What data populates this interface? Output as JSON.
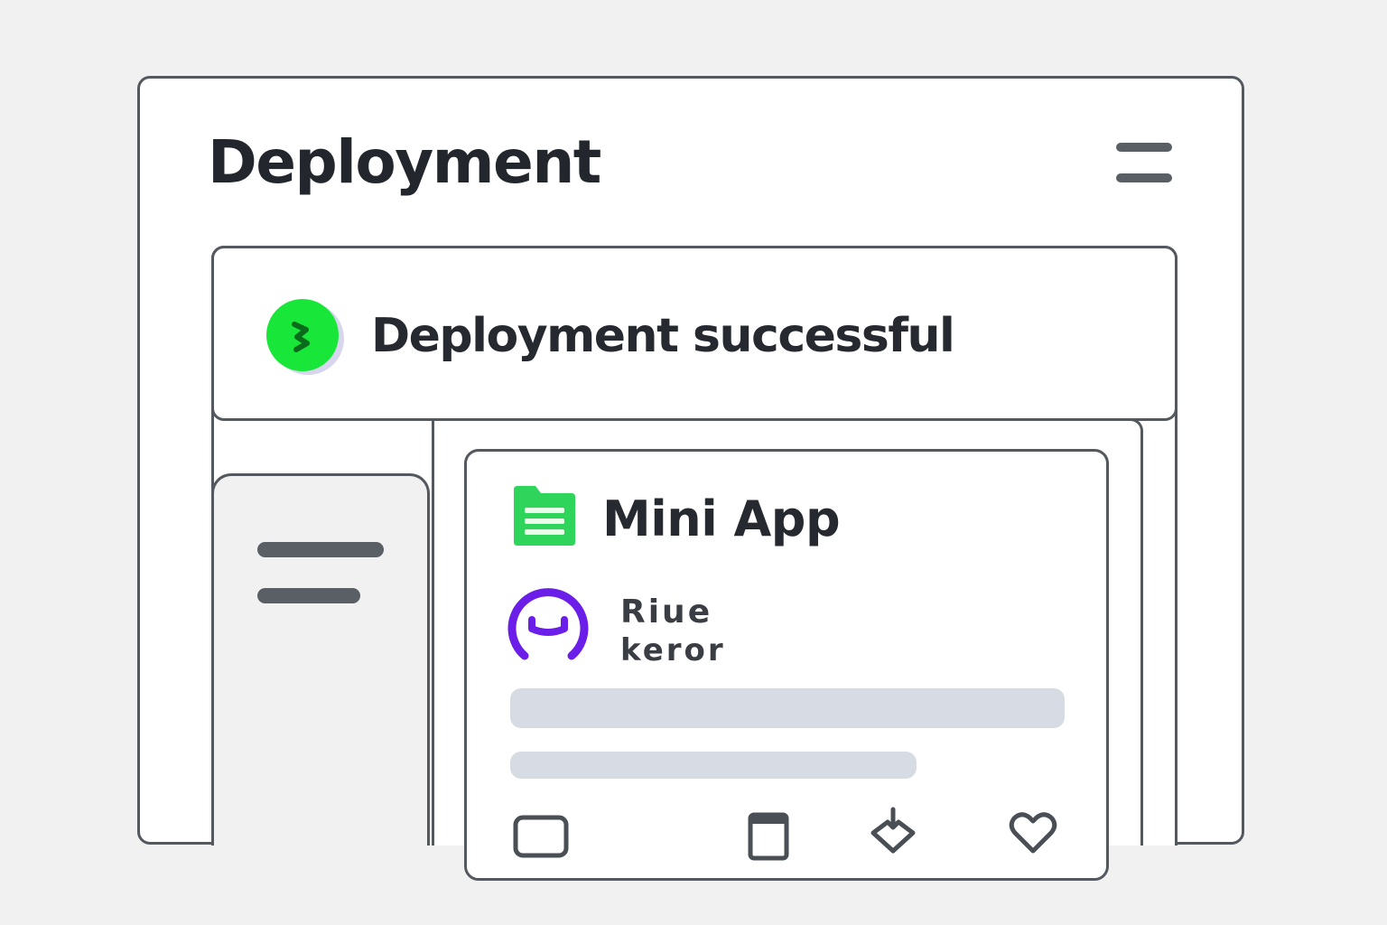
{
  "header": {
    "title": "Deployment",
    "menu_icon": "hamburger-menu-icon"
  },
  "toast": {
    "message": "Deployment successful",
    "status_icon": "success-check-icon",
    "status_color": "#18e639"
  },
  "app_card": {
    "title": "Mini App",
    "app_icon": "document-icon",
    "app_icon_color": "#2fd45a",
    "user": {
      "name": "Riue",
      "role": "keror",
      "avatar_icon": "user-avatar-icon",
      "avatar_color": "#6a1ee8"
    },
    "actions": [
      {
        "name": "card-icon"
      },
      {
        "name": "window-icon"
      },
      {
        "name": "share-icon"
      },
      {
        "name": "heart-icon"
      }
    ]
  }
}
